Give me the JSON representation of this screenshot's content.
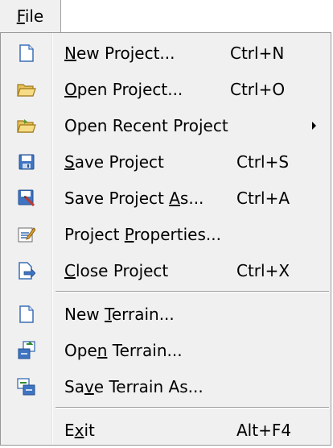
{
  "menubar": {
    "file_pre": "",
    "file_ul": "F",
    "file_post": "ile"
  },
  "menu": {
    "items": [
      {
        "pre": "",
        "ul": "N",
        "post": "ew Project...",
        "shortcut": "Ctrl+N",
        "icon": "new-document-icon"
      },
      {
        "pre": "",
        "ul": "O",
        "post": "pen Project...",
        "shortcut": "Ctrl+O",
        "icon": "open-folder-icon"
      },
      {
        "pre": "Open Recent Project",
        "ul": "",
        "post": "",
        "shortcut": "",
        "icon": "recent-folder-icon",
        "submenu": true
      },
      {
        "pre": "",
        "ul": "S",
        "post": "ave Project",
        "shortcut": "Ctrl+S",
        "icon": "save-disk-icon"
      },
      {
        "pre": "Save Project ",
        "ul": "A",
        "post": "s...",
        "shortcut": "Ctrl+A",
        "icon": "save-as-icon"
      },
      {
        "pre": "Project ",
        "ul": "P",
        "post": "roperties...",
        "shortcut": "",
        "icon": "properties-icon"
      },
      {
        "pre": "",
        "ul": "C",
        "post": "lose Project",
        "shortcut": "Ctrl+X",
        "icon": "close-project-icon"
      },
      {
        "pre": "New ",
        "ul": "T",
        "post": "errain...",
        "shortcut": "",
        "icon": "new-terrain-icon"
      },
      {
        "pre": "Ope",
        "ul": "n",
        "post": " Terrain...",
        "shortcut": "",
        "icon": "open-terrain-icon"
      },
      {
        "pre": "Sa",
        "ul": "v",
        "post": "e Terrain As...",
        "shortcut": "",
        "icon": "save-terrain-icon"
      },
      {
        "pre": "E",
        "ul": "x",
        "post": "it",
        "shortcut": "Alt+F4",
        "icon": ""
      }
    ]
  },
  "colors": {
    "menu_bg": "#f0f0f0",
    "border": "#979797",
    "separator": "#a0a0a0"
  }
}
